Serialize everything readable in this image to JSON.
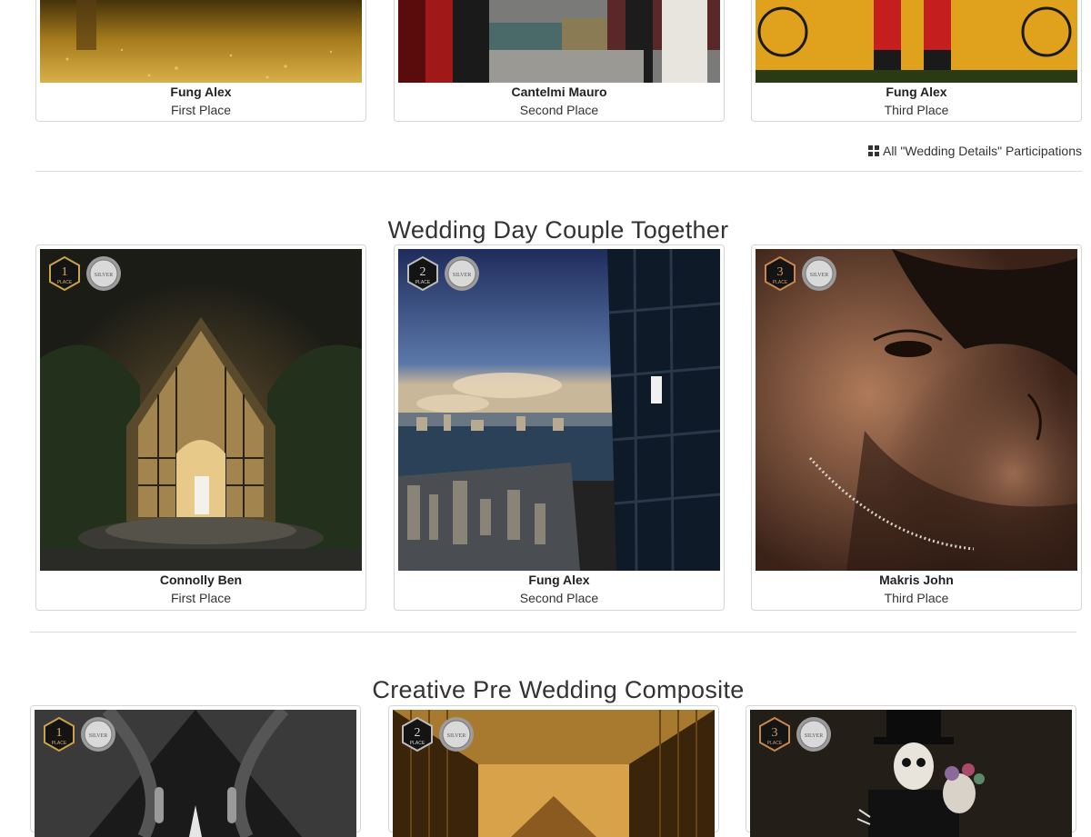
{
  "sections": {
    "wedding_details": {
      "entries": [
        {
          "name": "Fung Alex",
          "place": "First Place"
        },
        {
          "name": "Cantelmi Mauro",
          "place": "Second Place"
        },
        {
          "name": "Fung Alex",
          "place": "Third Place"
        }
      ],
      "participations_link": "All \"Wedding Details\" Participations"
    },
    "couple_together": {
      "title": "Wedding Day Couple Together",
      "entries": [
        {
          "name": "Connolly Ben",
          "place": "First Place"
        },
        {
          "name": "Fung Alex",
          "place": "Second Place"
        },
        {
          "name": "Makris John",
          "place": "Third Place"
        }
      ]
    },
    "pre_wedding": {
      "title": "Creative Pre Wedding Composite"
    }
  },
  "badges": {
    "place_word": "PLACE",
    "seal_word": "SILVER",
    "first": "1",
    "second": "2",
    "third": "3"
  },
  "icons": {
    "participations": "grid-icon"
  },
  "colors": {
    "gold": "#c9a24a",
    "silver": "#b5b5b5"
  }
}
